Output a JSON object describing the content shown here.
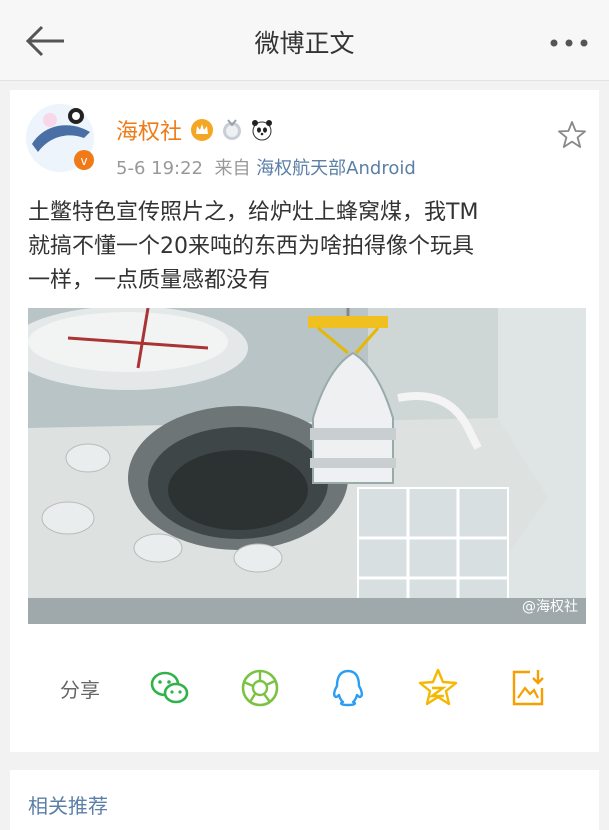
{
  "header": {
    "title": "微博正文",
    "back_icon": "arrow-left-icon",
    "more_icon": "more-dots-icon"
  },
  "post": {
    "author": "海权社",
    "timestamp": "5-6 19:22",
    "from_label": "来自",
    "source": "海权航天部Android",
    "lines": [
      "土鳖特色宣传照片之，给炉灶上蜂窝煤，我TM",
      "就搞不懂一个20来吨的东西为啥拍得像个玩具",
      "一样，一点质量感都没有"
    ],
    "image_watermark": "@海权社"
  },
  "share": {
    "label": "分享",
    "targets": [
      "wechat-icon",
      "moments-icon",
      "qq-icon",
      "qzone-icon",
      "save-image-icon"
    ]
  },
  "related": {
    "title": "相关推荐"
  },
  "colors": {
    "brand_orange": "#f07a17",
    "link_blue": "#5b7fa7",
    "wechat_green": "#2fb34a",
    "qq_blue": "#2c9df4",
    "qzone_yellow": "#f5b800"
  }
}
